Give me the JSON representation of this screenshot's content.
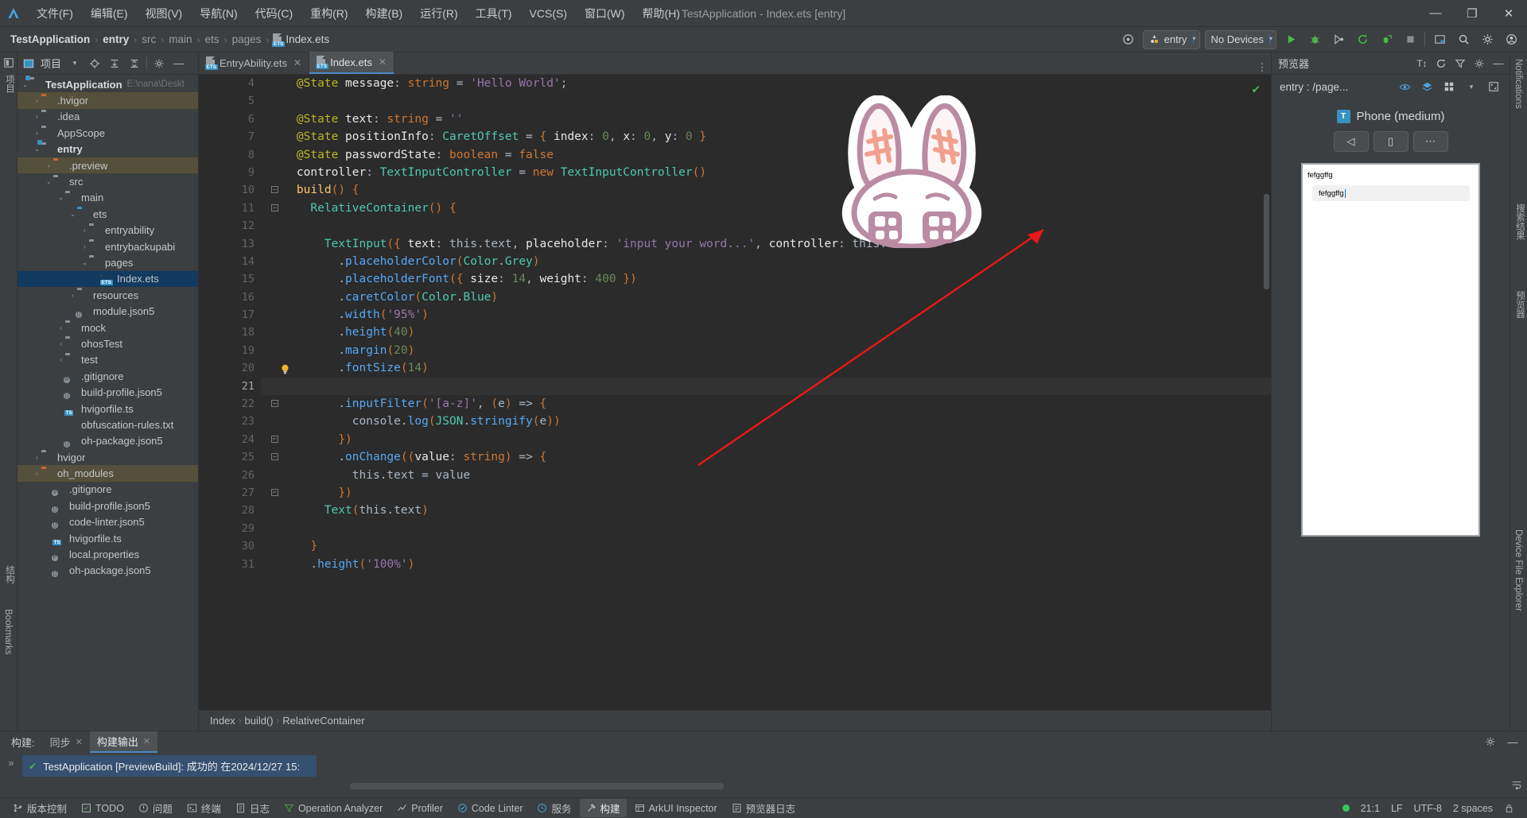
{
  "window": {
    "title": "TestApplication - Index.ets [entry]",
    "minimize": "—",
    "restore": "❐",
    "close": "✕"
  },
  "menu": [
    {
      "label": "文件(F)",
      "name": "menu-file"
    },
    {
      "label": "编辑(E)",
      "name": "menu-edit"
    },
    {
      "label": "视图(V)",
      "name": "menu-view"
    },
    {
      "label": "导航(N)",
      "name": "menu-navigate"
    },
    {
      "label": "代码(C)",
      "name": "menu-code"
    },
    {
      "label": "重构(R)",
      "name": "menu-refactor"
    },
    {
      "label": "构建(B)",
      "name": "menu-build"
    },
    {
      "label": "运行(R)",
      "name": "menu-run"
    },
    {
      "label": "工具(T)",
      "name": "menu-tools"
    },
    {
      "label": "VCS(S)",
      "name": "menu-vcs"
    },
    {
      "label": "窗口(W)",
      "name": "menu-window"
    },
    {
      "label": "帮助(H)",
      "name": "menu-help"
    }
  ],
  "breadcrumb": {
    "items": [
      "TestApplication",
      "entry",
      "src",
      "main",
      "ets",
      "pages"
    ],
    "file": "Index.ets",
    "separator": "›"
  },
  "toolbar": {
    "device_target": "entry",
    "devices": "No Devices",
    "caret": "▾",
    "run_tooltip": "Run",
    "debug_tooltip": "Debug",
    "profile_tooltip": "Profile",
    "sync_tooltip": "Sync",
    "attach_tooltip": "Attach",
    "stop_tooltip": "Stop",
    "search_tooltip": "Search",
    "settings_tooltip": "Settings",
    "account_tooltip": "Account"
  },
  "project_panel": {
    "title": "项目",
    "tree": [
      {
        "label": "TestApplication",
        "sub": "E:\\nana\\Deskt",
        "depth": 0,
        "arrow": "open",
        "icon": "folder-module",
        "bold": true,
        "state": "normal"
      },
      {
        "label": ".hvigor",
        "depth": 1,
        "arrow": "closed",
        "icon": "folder-orange",
        "state": "hl"
      },
      {
        "label": ".idea",
        "depth": 1,
        "arrow": "closed",
        "icon": "folder",
        "state": "normal"
      },
      {
        "label": "AppScope",
        "depth": 1,
        "arrow": "closed",
        "icon": "folder",
        "state": "normal"
      },
      {
        "label": "entry",
        "depth": 1,
        "arrow": "open",
        "icon": "folder-module",
        "bold": true,
        "state": "normal"
      },
      {
        "label": ".preview",
        "depth": 2,
        "arrow": "closed",
        "icon": "folder-orange",
        "state": "hl"
      },
      {
        "label": "src",
        "depth": 2,
        "arrow": "open",
        "icon": "folder",
        "state": "normal"
      },
      {
        "label": "main",
        "depth": 3,
        "arrow": "open",
        "icon": "folder",
        "state": "normal"
      },
      {
        "label": "ets",
        "depth": 4,
        "arrow": "open",
        "icon": "folder-blue",
        "state": "normal"
      },
      {
        "label": "entryability",
        "depth": 5,
        "arrow": "closed",
        "icon": "folder",
        "state": "normal"
      },
      {
        "label": "entrybackupabi",
        "depth": 5,
        "arrow": "closed",
        "icon": "folder",
        "state": "normal"
      },
      {
        "label": "pages",
        "depth": 5,
        "arrow": "open",
        "icon": "folder",
        "state": "normal"
      },
      {
        "label": "Index.ets",
        "depth": 6,
        "arrow": "none",
        "icon": "file-ets",
        "state": "sel"
      },
      {
        "label": "resources",
        "depth": 4,
        "arrow": "closed",
        "icon": "folder",
        "state": "normal"
      },
      {
        "label": "module.json5",
        "depth": 4,
        "arrow": "none",
        "icon": "file-json",
        "state": "normal"
      },
      {
        "label": "mock",
        "depth": 3,
        "arrow": "closed",
        "icon": "folder",
        "state": "normal"
      },
      {
        "label": "ohosTest",
        "depth": 3,
        "arrow": "closed",
        "icon": "folder",
        "state": "normal"
      },
      {
        "label": "test",
        "depth": 3,
        "arrow": "closed",
        "icon": "folder",
        "state": "normal"
      },
      {
        "label": ".gitignore",
        "depth": 3,
        "arrow": "none",
        "icon": "file-ignore",
        "state": "normal"
      },
      {
        "label": "build-profile.json5",
        "depth": 3,
        "arrow": "none",
        "icon": "file-json",
        "state": "normal"
      },
      {
        "label": "hvigorfile.ts",
        "depth": 3,
        "arrow": "none",
        "icon": "file-ts",
        "state": "normal"
      },
      {
        "label": "obfuscation-rules.txt",
        "depth": 3,
        "arrow": "none",
        "icon": "file-txt",
        "state": "normal"
      },
      {
        "label": "oh-package.json5",
        "depth": 3,
        "arrow": "none",
        "icon": "file-json",
        "state": "normal"
      },
      {
        "label": "hvigor",
        "depth": 1,
        "arrow": "closed",
        "icon": "folder",
        "state": "normal"
      },
      {
        "label": "oh_modules",
        "depth": 1,
        "arrow": "closed",
        "icon": "folder-orange",
        "state": "hl"
      },
      {
        "label": ".gitignore",
        "depth": 2,
        "arrow": "none",
        "icon": "file-ignore",
        "state": "normal"
      },
      {
        "label": "build-profile.json5",
        "depth": 2,
        "arrow": "none",
        "icon": "file-json",
        "state": "normal"
      },
      {
        "label": "code-linter.json5",
        "depth": 2,
        "arrow": "none",
        "icon": "file-json",
        "state": "normal"
      },
      {
        "label": "hvigorfile.ts",
        "depth": 2,
        "arrow": "none",
        "icon": "file-ts",
        "state": "normal"
      },
      {
        "label": "local.properties",
        "depth": 2,
        "arrow": "none",
        "icon": "file-props",
        "state": "normal"
      },
      {
        "label": "oh-package.json5",
        "depth": 2,
        "arrow": "none",
        "icon": "file-json",
        "state": "normal"
      }
    ]
  },
  "editor": {
    "tabs": [
      {
        "label": "EntryAbility.ets",
        "active": false,
        "close": "✕"
      },
      {
        "label": "Index.ets",
        "active": true,
        "close": "✕"
      }
    ],
    "first_line": 4,
    "lines": [
      {
        "n": 4,
        "text": "    @State message: string = 'Hello World';"
      },
      {
        "n": 5,
        "text": ""
      },
      {
        "n": 6,
        "text": "    @State text: string = ''"
      },
      {
        "n": 7,
        "text": "    @State positionInfo: CaretOffset = { index: 0, x: 0, y: 0 }"
      },
      {
        "n": 8,
        "text": "    @State passwordState: boolean = false"
      },
      {
        "n": 9,
        "text": "    controller: TextInputController = new TextInputController()"
      },
      {
        "n": 10,
        "text": "    build() {"
      },
      {
        "n": 11,
        "text": "      RelativeContainer() {"
      },
      {
        "n": 12,
        "text": ""
      },
      {
        "n": 13,
        "text": "        TextInput({ text: this.text, placeholder: 'input your word...', controller: this.c"
      },
      {
        "n": 14,
        "text": "          .placeholderColor(Color.Grey)"
      },
      {
        "n": 15,
        "text": "          .placeholderFont({ size: 14, weight: 400 })"
      },
      {
        "n": 16,
        "text": "          .caretColor(Color.Blue)"
      },
      {
        "n": 17,
        "text": "          .width('95%')"
      },
      {
        "n": 18,
        "text": "          .height(40)"
      },
      {
        "n": 19,
        "text": "          .margin(20)"
      },
      {
        "n": 20,
        "text": "          .fontSize(14)"
      },
      {
        "n": 21,
        "text": ""
      },
      {
        "n": 22,
        "text": "          .inputFilter('[a-z]', (e) => {"
      },
      {
        "n": 23,
        "text": "            console.log(JSON.stringify(e))"
      },
      {
        "n": 24,
        "text": "          })"
      },
      {
        "n": 25,
        "text": "          .onChange((value: string) => {"
      },
      {
        "n": 26,
        "text": "            this.text = value"
      },
      {
        "n": 27,
        "text": "          })"
      },
      {
        "n": 28,
        "text": "        Text(this.text)"
      },
      {
        "n": 29,
        "text": ""
      },
      {
        "n": 30,
        "text": "      }"
      },
      {
        "n": 31,
        "text": "      .height('100%')"
      }
    ],
    "current_line": 21,
    "bulb_line": 20,
    "bottom_breadcrumb": [
      "Index",
      "build()",
      "RelativeContainer"
    ]
  },
  "preview": {
    "title": "预览器",
    "page_label": "entry : /page...",
    "device_name": "Phone (medium)",
    "device_badge": "T",
    "buttons": [
      "◁",
      "▯",
      "⋯"
    ],
    "phone_text": "fefggffg",
    "phone_input_value": "fefggffg"
  },
  "build_panel": {
    "label": "构建:",
    "tabs": [
      {
        "label": "同步",
        "close": "✕",
        "active": false
      },
      {
        "label": "构建输出",
        "close": "✕",
        "active": true
      }
    ],
    "message": "TestApplication [PreviewBuild]: 成功的 在2024/12/27 15:",
    "left_rail": "构建"
  },
  "status_bar": {
    "items": [
      {
        "label": "版本控制",
        "icon": "branch-icon",
        "name": "status-version-control"
      },
      {
        "label": "TODO",
        "icon": "checklist-icon",
        "name": "status-todo"
      },
      {
        "label": "问题",
        "icon": "warning-icon",
        "name": "status-problems"
      },
      {
        "label": "终端",
        "icon": "terminal-icon",
        "name": "status-terminal"
      },
      {
        "label": "日志",
        "icon": "log-icon",
        "name": "status-log"
      },
      {
        "label": "Operation Analyzer",
        "icon": "analyzer-icon",
        "name": "status-operation-analyzer"
      },
      {
        "label": "Profiler",
        "icon": "profiler-icon",
        "name": "status-profiler"
      },
      {
        "label": "Code Linter",
        "icon": "linter-icon",
        "name": "status-code-linter"
      },
      {
        "label": "服务",
        "icon": "service-icon",
        "name": "status-services"
      },
      {
        "label": "构建",
        "icon": "hammer-icon",
        "name": "status-build",
        "active": true
      },
      {
        "label": "ArkUI Inspector",
        "icon": "inspector-icon",
        "name": "status-arkui-inspector"
      },
      {
        "label": "预览器日志",
        "icon": "preview-log-icon",
        "name": "status-preview-log"
      }
    ],
    "caret_position": "21:1",
    "line_separator": "LF",
    "encoding": "UTF-8",
    "indent": "2 spaces"
  },
  "left_rail": {
    "top": "项目",
    "bottom": "Bookmarks",
    "mid": "结构"
  },
  "right_rail": {
    "top": "Notifications",
    "items": [
      "搜索结果",
      "预览器",
      "Device File Explorer"
    ]
  }
}
